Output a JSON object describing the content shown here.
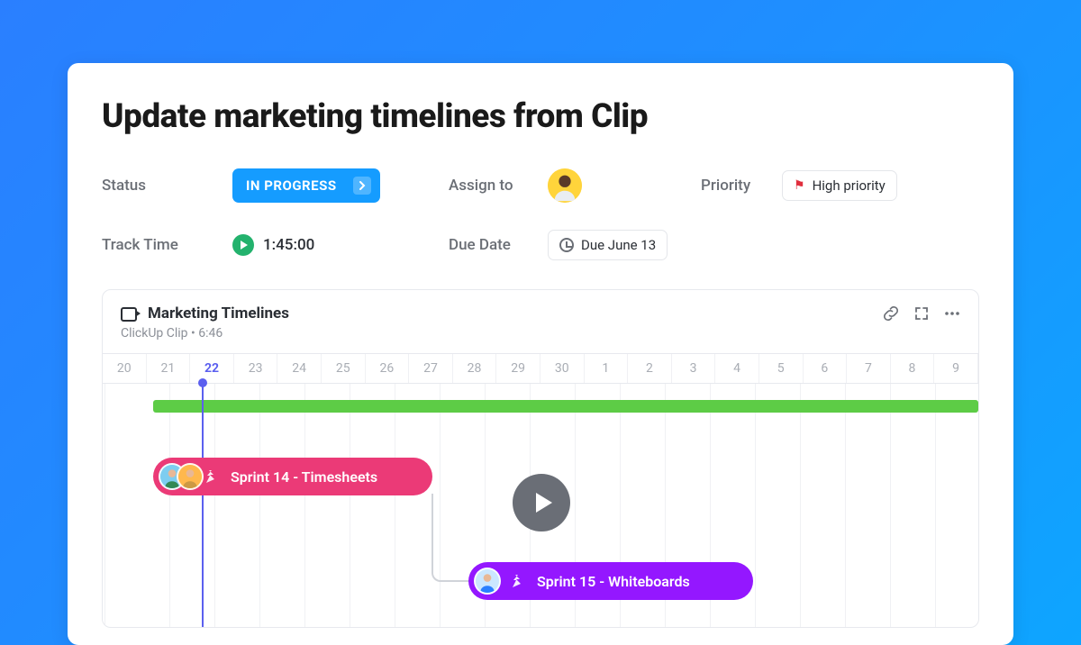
{
  "title": "Update marketing timelines from Clip",
  "labels": {
    "status": "Status",
    "assign_to": "Assign to",
    "priority": "Priority",
    "track_time": "Track Time",
    "due_date": "Due Date"
  },
  "status": {
    "label": "IN PROGRESS"
  },
  "priority": {
    "label": "High priority"
  },
  "track_time": "1:45:00",
  "due_date": "Due June 13",
  "clip": {
    "title": "Marketing Timelines",
    "subtitle": "ClickUp Clip • 6:46"
  },
  "timeline": {
    "dates": [
      "20",
      "21",
      "22",
      "23",
      "24",
      "25",
      "26",
      "27",
      "28",
      "29",
      "30",
      "1",
      "2",
      "3",
      "4",
      "5",
      "6",
      "7",
      "8",
      "9"
    ],
    "active_index": 2
  },
  "tasks": {
    "sprint14": "Sprint 14 - Timesheets",
    "sprint15": "Sprint 15 - Whiteboards"
  }
}
